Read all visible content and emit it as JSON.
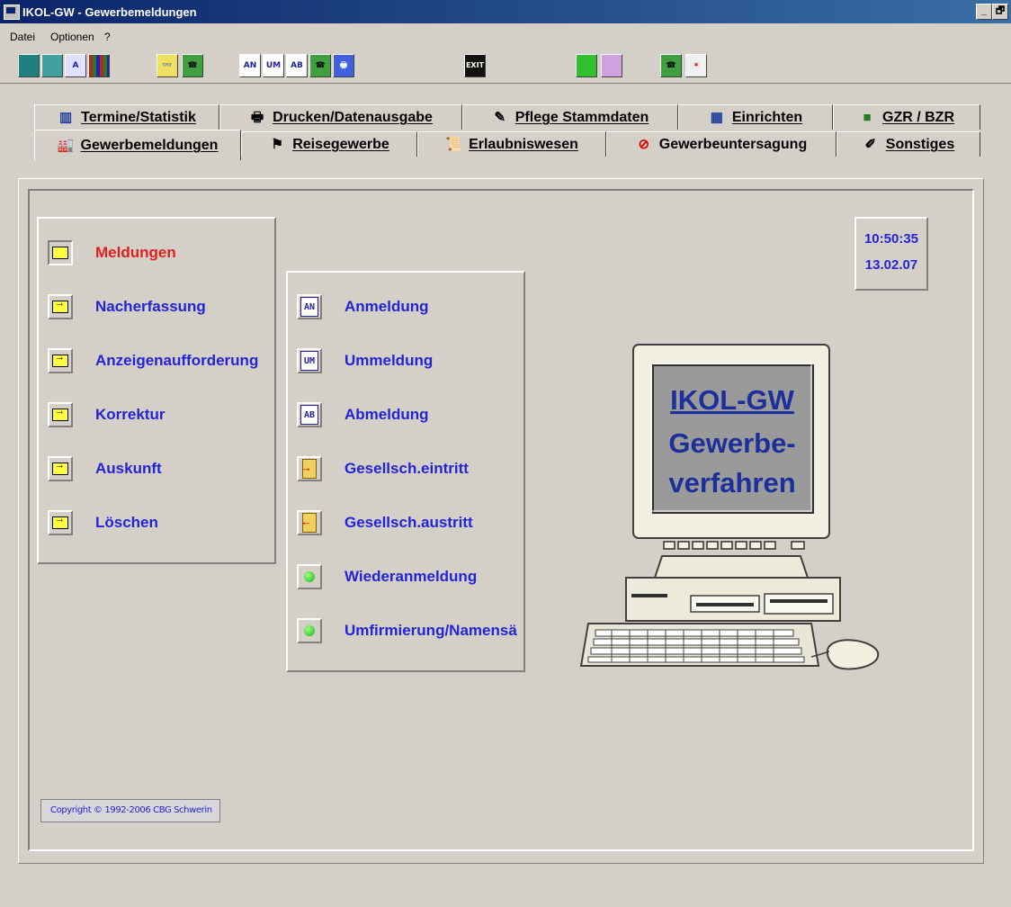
{
  "window": {
    "title": "IKOL-GW  -  Gewerbemeldungen",
    "min_label": "_",
    "restore_label": "🗗"
  },
  "menu": [
    "Datei",
    "Optionen",
    "?"
  ],
  "toolbar": {
    "an": "AN",
    "um": "UM",
    "ab": "AB",
    "exit": "EXIT"
  },
  "tabs_back": [
    {
      "label": "Termine/Statistik",
      "icon": "bar-chart-icon"
    },
    {
      "label": "Drucken/Datenausgabe",
      "icon": "printer-icon"
    },
    {
      "label": "Pflege Stammdaten",
      "icon": "edit-pen-icon"
    },
    {
      "label": "Einrichten",
      "icon": "table-icon"
    },
    {
      "label": "GZR / BZR",
      "icon": "register-icon"
    }
  ],
  "tabs_front": [
    {
      "label": "Gewerbemeldungen",
      "icon": "factory-icon"
    },
    {
      "label": "Reisegewerbe",
      "icon": "signpost-icon"
    },
    {
      "label": "Erlaubniswesen",
      "icon": "certificate-icon"
    },
    {
      "label": "Gewerbeuntersagung",
      "icon": "prohibited-icon"
    },
    {
      "label": "Sonstiges",
      "icon": "notepad-icon"
    }
  ],
  "left_panel": [
    {
      "label": "Meldungen",
      "active": true
    },
    {
      "label": "Nacherfassung",
      "active": false
    },
    {
      "label": "Anzeigenaufforderung",
      "active": false
    },
    {
      "label": "Korrektur",
      "active": false
    },
    {
      "label": "Auskunft",
      "active": false
    },
    {
      "label": "Löschen",
      "active": false
    }
  ],
  "middle_panel": [
    {
      "label": "Anmeldung",
      "icon": "AN"
    },
    {
      "label": "Ummeldung",
      "icon": "UM"
    },
    {
      "label": "Abmeldung",
      "icon": "AB"
    },
    {
      "label": "Gesellsch.eintritt",
      "icon": "door-in"
    },
    {
      "label": "Gesellsch.austritt",
      "icon": "door-out"
    },
    {
      "label": "Wiederanmeldung",
      "icon": "green-dot"
    },
    {
      "label": "Umfirmierung/Namensä",
      "icon": "green-dot"
    }
  ],
  "clock": {
    "time": "10:50:35",
    "date": "13.02.07"
  },
  "monitor": {
    "line1": "IKOL-GW",
    "line2": "Gewerbe-",
    "line3": "verfahren"
  },
  "copyright": "Copyright © 1992-2006  CBG Schwerin"
}
